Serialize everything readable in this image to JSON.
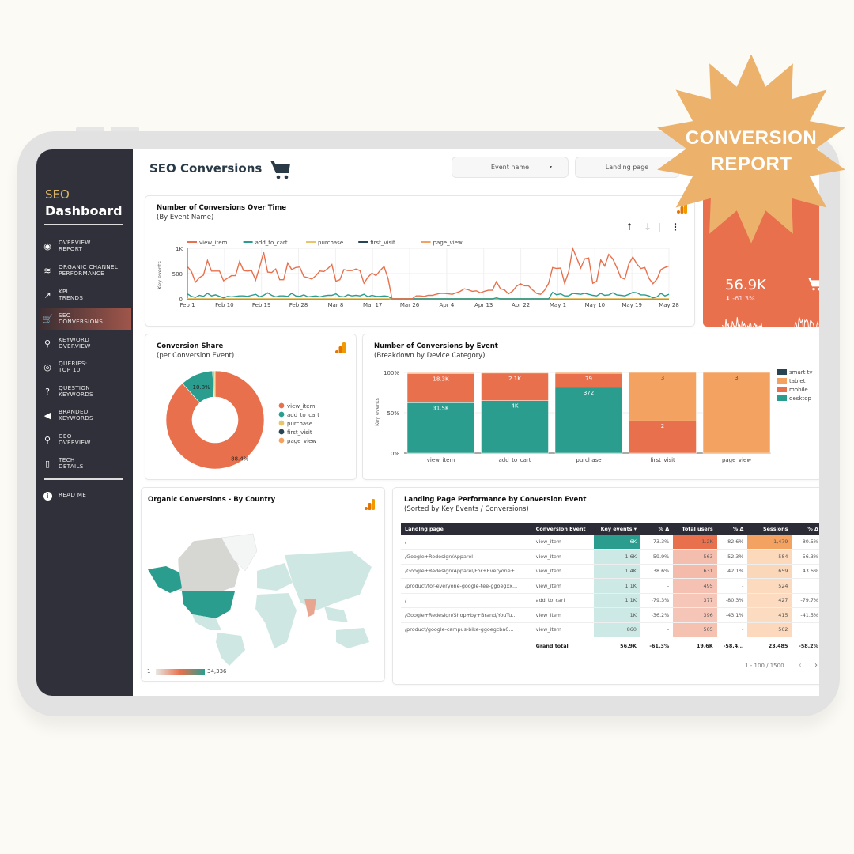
{
  "badge": {
    "line1": "CONVERSION",
    "line2": "REPORT",
    "color": "#ecb26b"
  },
  "sidebar": {
    "brand_top": "SEO",
    "brand_bottom": "Dashboard",
    "items": [
      {
        "label1": "OVERVIEW",
        "label2": "REPORT",
        "icon": "eye-icon",
        "glyph": "◉"
      },
      {
        "label1": "ORGANIC CHANNEL",
        "label2": "PERFORMANCE",
        "icon": "layers-icon",
        "glyph": "≋"
      },
      {
        "label1": "KPI",
        "label2": "TRENDS",
        "icon": "trend-chart-icon",
        "glyph": "↗"
      },
      {
        "label1": "SEO",
        "label2": "CONVERSIONS",
        "icon": "cart-icon",
        "glyph": "🛒",
        "active": true
      },
      {
        "label1": "KEYWORD",
        "label2": "OVERVIEW",
        "icon": "search-icon",
        "glyph": "⚲"
      },
      {
        "label1": "QUERIES:",
        "label2": "TOP 10",
        "icon": "target-icon",
        "glyph": "◎"
      },
      {
        "label1": "QUESTION",
        "label2": "KEYWORDS",
        "icon": "question-icon",
        "glyph": "?"
      },
      {
        "label1": "BRANDED",
        "label2": "KEYWORDS",
        "icon": "megaphone-icon",
        "glyph": "◀"
      },
      {
        "label1": "GEO",
        "label2": "OVERVIEW",
        "icon": "location-pin-icon",
        "glyph": "⚲"
      },
      {
        "label1": "TECH",
        "label2": "DETAILS",
        "icon": "mobile-device-icon",
        "glyph": "▯"
      }
    ],
    "readme": {
      "label": "READ ME",
      "icon": "info-icon",
      "glyph": "i"
    }
  },
  "header": {
    "title": "SEO Conversions",
    "filters": [
      {
        "label": "Event name",
        "caret": "▾"
      },
      {
        "label": "Landing page"
      }
    ]
  },
  "kpi": {
    "value": "56.9K",
    "delta": "⬇ -61.3%"
  },
  "colors": {
    "orange": "#e8704d",
    "teal": "#2a9d8f",
    "yellow": "#e9c46a",
    "navy": "#264653",
    "peach": "#f4a261"
  },
  "charts": {
    "timeseries": {
      "title": "Number of Conversions Over Time",
      "subtitle": "(By Event Name)",
      "sort_up": "↑",
      "sort_down": "↓",
      "menu": "⋮"
    },
    "donut": {
      "title": "Conversion Share",
      "subtitle": "(per Conversion Event)"
    },
    "stacked": {
      "title": "Number of Conversions by Event",
      "subtitle": "(Breakdown by Device Category)"
    },
    "map": {
      "title": "Organic Conversions - By Country",
      "scale_min": "1",
      "scale_max": "34,336"
    }
  },
  "chart_data": [
    {
      "type": "line",
      "title": "Number of Conversions Over Time (By Event Name)",
      "ylabel": "Key events",
      "ylim": [
        0,
        1000
      ],
      "yticks": [
        "0",
        "500",
        "1K"
      ],
      "xticks": [
        "Feb 1",
        "Feb 10",
        "Feb 19",
        "Feb 28",
        "Mar 8",
        "Mar 17",
        "Mar 26",
        "Apr 4",
        "Apr 13",
        "Apr 22",
        "May 1",
        "May 10",
        "May 19",
        "May 28"
      ],
      "legend": [
        "view_item",
        "add_to_cart",
        "purchase",
        "first_visit",
        "page_view"
      ],
      "legend_position": "top-left",
      "series": [
        {
          "name": "view_item",
          "color": "#e8704d",
          "values": [
            640,
            540,
            330,
            420,
            470,
            760,
            550,
            550,
            550,
            360,
            410,
            460,
            460,
            740,
            560,
            550,
            560,
            370,
            630,
            920,
            530,
            520,
            590,
            380,
            380,
            710,
            580,
            620,
            630,
            440,
            420,
            390,
            460,
            550,
            540,
            600,
            680,
            350,
            380,
            580,
            560,
            560,
            590,
            560,
            310,
            430,
            510,
            460,
            560,
            640,
            400,
            0,
            0,
            0,
            0,
            0,
            0,
            60,
            60,
            50,
            70,
            70,
            90,
            110,
            110,
            100,
            90,
            120,
            150,
            200,
            180,
            150,
            160,
            120,
            150,
            170,
            170,
            340,
            200,
            180,
            100,
            150,
            250,
            300,
            260,
            260,
            180,
            110,
            90,
            170,
            310,
            620,
            600,
            610,
            310,
            530,
            1000,
            810,
            610,
            790,
            810,
            310,
            350,
            770,
            650,
            880,
            790,
            620,
            420,
            390,
            690,
            830,
            690,
            600,
            620,
            410,
            300,
            390,
            580,
            620,
            650
          ]
        },
        {
          "name": "add_to_cart",
          "color": "#2a9d8f",
          "values": [
            100,
            50,
            30,
            70,
            50,
            110,
            60,
            80,
            50,
            20,
            50,
            40,
            50,
            60,
            60,
            50,
            70,
            90,
            40,
            70,
            120,
            70,
            40,
            60,
            60,
            50,
            110,
            60,
            50,
            80,
            40,
            50,
            60,
            40,
            60,
            70,
            70,
            100,
            50,
            40,
            80,
            60,
            70,
            60,
            90,
            40,
            70,
            50,
            50,
            60,
            50,
            0,
            0,
            0,
            0,
            0,
            0,
            0,
            0,
            0,
            0,
            0,
            0,
            0,
            0,
            0,
            0,
            0,
            0,
            0,
            0,
            0,
            0,
            0,
            0,
            0,
            0,
            20,
            0,
            0,
            0,
            0,
            0,
            0,
            0,
            0,
            0,
            0,
            0,
            0,
            0,
            130,
            80,
            100,
            60,
            60,
            110,
            100,
            90,
            110,
            90,
            70,
            60,
            110,
            70,
            80,
            120,
            80,
            70,
            60,
            90,
            130,
            120,
            80,
            80,
            60,
            20,
            40,
            110,
            60,
            90
          ]
        },
        {
          "name": "purchase",
          "color": "#e9c46a",
          "values": [
            5,
            5,
            5,
            5,
            5,
            5,
            5,
            5,
            5,
            5,
            5,
            5,
            5,
            5,
            5,
            5,
            5,
            5,
            5,
            5,
            5,
            5,
            5,
            5,
            5,
            5,
            5,
            5,
            5,
            5,
            5,
            5,
            5,
            5,
            5,
            5,
            5,
            5,
            5,
            5,
            5,
            5,
            5,
            5,
            5,
            5,
            5,
            5,
            5,
            5,
            5,
            0,
            0,
            0,
            0,
            0,
            0,
            0,
            0,
            0,
            0,
            0,
            0,
            0,
            0,
            0,
            0,
            0,
            0,
            0,
            0,
            0,
            0,
            0,
            0,
            0,
            0,
            0,
            0,
            0,
            0,
            0,
            0,
            0,
            0,
            0,
            0,
            0,
            0,
            0,
            0,
            5,
            5,
            5,
            5,
            5,
            5,
            5,
            5,
            5,
            5,
            5,
            5,
            5,
            5,
            5,
            5,
            5,
            5,
            5,
            5,
            5,
            5,
            5,
            5,
            5,
            5,
            5,
            5,
            5,
            5
          ]
        },
        {
          "name": "first_visit",
          "color": "#264653",
          "values": [
            0
          ]
        },
        {
          "name": "page_view",
          "color": "#f4a261",
          "values": [
            0
          ]
        }
      ]
    },
    {
      "type": "pie",
      "title": "Conversion Share (per Conversion Event)",
      "legend_position": "right",
      "categories": [
        "view_item",
        "add_to_cart",
        "purchase",
        "first_visit",
        "page_view"
      ],
      "values": [
        88.4,
        10.8,
        0.8,
        0.01,
        0.01
      ],
      "data_labels": [
        "88.4%",
        "10.8%",
        "",
        "",
        ""
      ],
      "colors": [
        "#e8704d",
        "#2a9d8f",
        "#e9c46a",
        "#264653",
        "#f4a261"
      ]
    },
    {
      "type": "bar",
      "stacked": "percent",
      "title": "Number of Conversions by Event (Breakdown by Device Category)",
      "ylabel": "Key events",
      "yticks": [
        "0%",
        "50%",
        "100%"
      ],
      "categories": [
        "view_item",
        "add_to_cart",
        "purchase",
        "first_visit",
        "page_view"
      ],
      "legend": [
        "smart tv",
        "tablet",
        "mobile",
        "desktop"
      ],
      "legend_position": "right",
      "series": [
        {
          "name": "desktop",
          "color": "#2a9d8f",
          "values": [
            31500,
            4000,
            372,
            0,
            0
          ],
          "labels": [
            "31.5K",
            "4K",
            "372",
            "",
            ""
          ]
        },
        {
          "name": "mobile",
          "color": "#e8704d",
          "values": [
            18300,
            2100,
            79,
            2,
            0
          ],
          "labels": [
            "18.3K",
            "2.1K",
            "79",
            "2",
            ""
          ]
        },
        {
          "name": "tablet",
          "color": "#f4a261",
          "values": [
            500,
            50,
            5,
            3,
            3
          ],
          "labels": [
            "",
            "",
            "",
            "3",
            "3"
          ]
        },
        {
          "name": "smart tv",
          "color": "#264653",
          "values": [
            150,
            0,
            0,
            0,
            0
          ],
          "labels": [
            "",
            "",
            "",
            "",
            ""
          ]
        }
      ]
    },
    {
      "type": "table",
      "title": "Landing Page Performance by Conversion Event",
      "subtitle": "(Sorted by Key Events / Conversions)",
      "columns": [
        "Landing page",
        "Conversion Event",
        "Key events ▾",
        "% Δ",
        "Total users",
        "% Δ",
        "Sessions",
        "% Δ"
      ],
      "rows": [
        [
          "/",
          "view_item",
          "6K",
          "-73.3%",
          "1.2K",
          "-82.6%",
          "1,479",
          "-80.5%"
        ],
        [
          "/Google+Redesign/Apparel",
          "view_item",
          "1.6K",
          "-59.9%",
          "563",
          "-52.3%",
          "584",
          "-56.3%"
        ],
        [
          "/Google+Redesign/Apparel/For+Everyone+...",
          "view_item",
          "1.4K",
          "38.6%",
          "631",
          "42.1%",
          "659",
          "43.6%"
        ],
        [
          "/product/for-everyone-google-tee-ggoegxx...",
          "view_item",
          "1.1K",
          "-",
          "495",
          "-",
          "524",
          ""
        ],
        [
          "/",
          "add_to_cart",
          "1.1K",
          "-79.3%",
          "377",
          "-80.3%",
          "427",
          "-79.7%"
        ],
        [
          "/Google+Redesign/Shop+by+Brand/YouTu...",
          "view_item",
          "1K",
          "-36.2%",
          "396",
          "-43.1%",
          "415",
          "-41.5%"
        ],
        [
          "/product/google-campus-bike-ggoegcba0...",
          "view_item",
          "860",
          "-",
          "505",
          "-",
          "562",
          ""
        ]
      ],
      "heat": {
        "key_events": [
          1,
          0.27,
          0.23,
          0.18,
          0.18,
          0.17,
          0.14
        ],
        "users": [
          1,
          0.47,
          0.53,
          0.41,
          0.31,
          0.33,
          0.42
        ],
        "sessions": [
          1,
          0.39,
          0.45,
          0.35,
          0.29,
          0.28,
          0.38
        ]
      },
      "total": [
        "",
        "Grand total",
        "56.9K",
        "-61.3%",
        "19.6K",
        "-58.4...",
        "23,485",
        "-58.2%"
      ],
      "pagination": "1 - 100 / 1500",
      "prev": "‹",
      "next": "›"
    }
  ]
}
